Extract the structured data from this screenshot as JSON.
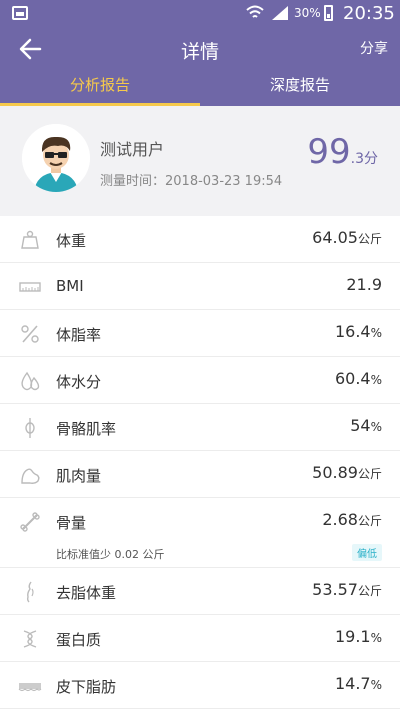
{
  "status": {
    "battery": "30%",
    "time": "20:35"
  },
  "appbar": {
    "title": "详情",
    "share": "分享"
  },
  "tabs": [
    {
      "label": "分析报告",
      "active": true
    },
    {
      "label": "深度报告",
      "active": false
    }
  ],
  "profile": {
    "name": "测试用户",
    "time_label": "测量时间：2018-03-23 19:54",
    "score_int": "99",
    "score_dec": ".3分"
  },
  "metrics": [
    {
      "icon": "weight-icon",
      "label": "体重",
      "value": "64.05",
      "unit": "公斤"
    },
    {
      "icon": "bmi-icon",
      "label": "BMI",
      "value": "21.9",
      "unit": ""
    },
    {
      "icon": "percent-icon",
      "label": "体脂率",
      "value": "16.4",
      "unit": "%"
    },
    {
      "icon": "water-drop-icon",
      "label": "体水分",
      "value": "60.4",
      "unit": "%"
    },
    {
      "icon": "skeleton-icon",
      "label": "骨骼肌率",
      "value": "54",
      "unit": "%"
    },
    {
      "icon": "muscle-icon",
      "label": "肌肉量",
      "value": "50.89",
      "unit": "公斤"
    },
    {
      "icon": "bone-icon",
      "label": "骨量",
      "value": "2.68",
      "unit": "公斤",
      "note": "比标准值少 0.02 公斤",
      "badge": "偏低"
    },
    {
      "icon": "body-silhouette-icon",
      "label": "去脂体重",
      "value": "53.57",
      "unit": "公斤"
    },
    {
      "icon": "dna-icon",
      "label": "蛋白质",
      "value": "19.1",
      "unit": "%"
    },
    {
      "icon": "fat-layer-icon",
      "label": "皮下脂肪",
      "value": "14.7",
      "unit": "%"
    }
  ],
  "colors": {
    "brand": "#6f67a7",
    "accent": "#f6c94b",
    "badge": "#2ab0c8"
  }
}
